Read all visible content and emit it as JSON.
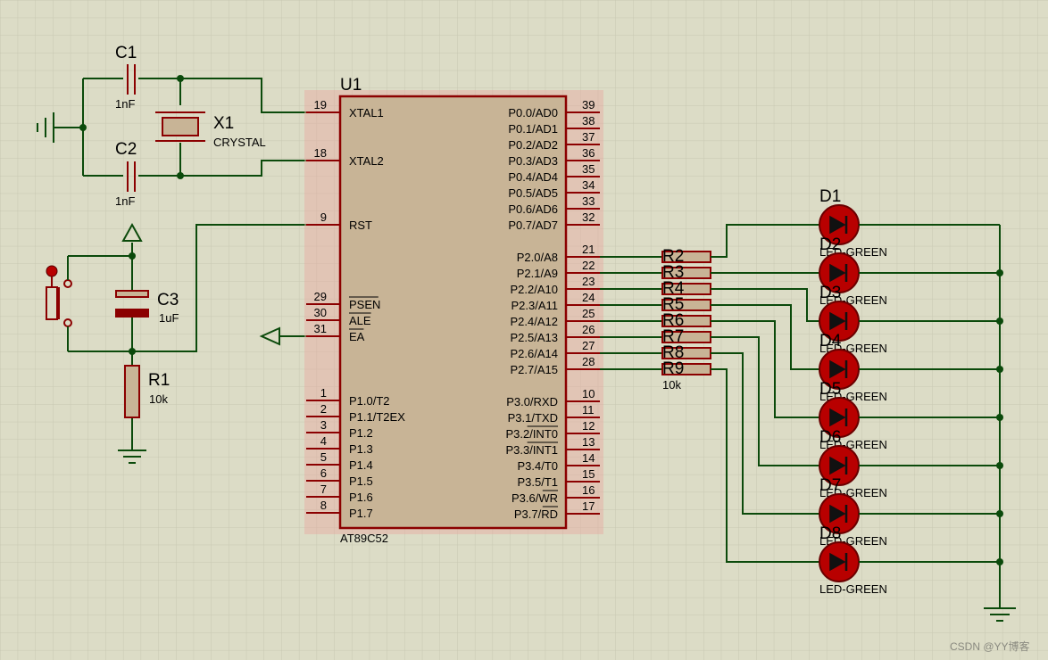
{
  "mcu": {
    "ref": "U1",
    "part": "AT89C52",
    "left_pins": [
      {
        "num": "19",
        "name": "XTAL1"
      },
      {
        "num": "18",
        "name": "XTAL2"
      },
      {
        "num": "9",
        "name": "RST"
      },
      {
        "num": "29",
        "name": "PSEN",
        "overline": true
      },
      {
        "num": "30",
        "name": "ALE",
        "overline": true
      },
      {
        "num": "31",
        "name": "EA",
        "overline": true
      },
      {
        "num": "1",
        "name": "P1.0/T2"
      },
      {
        "num": "2",
        "name": "P1.1/T2EX"
      },
      {
        "num": "3",
        "name": "P1.2"
      },
      {
        "num": "4",
        "name": "P1.3"
      },
      {
        "num": "5",
        "name": "P1.4"
      },
      {
        "num": "6",
        "name": "P1.5"
      },
      {
        "num": "7",
        "name": "P1.6"
      },
      {
        "num": "8",
        "name": "P1.7"
      }
    ],
    "right_pins": [
      {
        "num": "39",
        "name": "P0.0/AD0"
      },
      {
        "num": "38",
        "name": "P0.1/AD1"
      },
      {
        "num": "37",
        "name": "P0.2/AD2"
      },
      {
        "num": "36",
        "name": "P0.3/AD3"
      },
      {
        "num": "35",
        "name": "P0.4/AD4"
      },
      {
        "num": "34",
        "name": "P0.5/AD5"
      },
      {
        "num": "33",
        "name": "P0.6/AD6"
      },
      {
        "num": "32",
        "name": "P0.7/AD7"
      },
      {
        "num": "21",
        "name": "P2.0/A8"
      },
      {
        "num": "22",
        "name": "P2.1/A9"
      },
      {
        "num": "23",
        "name": "P2.2/A10"
      },
      {
        "num": "24",
        "name": "P2.3/A11"
      },
      {
        "num": "25",
        "name": "P2.4/A12"
      },
      {
        "num": "26",
        "name": "P2.5/A13"
      },
      {
        "num": "27",
        "name": "P2.6/A14"
      },
      {
        "num": "28",
        "name": "P2.7/A15"
      },
      {
        "num": "10",
        "name": "P3.0/RXD"
      },
      {
        "num": "11",
        "name": "P3.1/TXD"
      },
      {
        "num": "12",
        "name": "P3.2/INT0",
        "over_part": "INT0"
      },
      {
        "num": "13",
        "name": "P3.3/INT1",
        "over_part": "INT1"
      },
      {
        "num": "14",
        "name": "P3.4/T0"
      },
      {
        "num": "15",
        "name": "P3.5/T1"
      },
      {
        "num": "16",
        "name": "P3.6/WR",
        "over_part": "WR"
      },
      {
        "num": "17",
        "name": "P3.7/RD",
        "over_part": "RD"
      }
    ]
  },
  "c1": {
    "ref": "C1",
    "value": "1nF"
  },
  "c2": {
    "ref": "C2",
    "value": "1nF"
  },
  "x1": {
    "ref": "X1",
    "value": "CRYSTAL"
  },
  "c3": {
    "ref": "C3",
    "value": "1uF"
  },
  "r1": {
    "ref": "R1",
    "value": "10k"
  },
  "resistors": {
    "refs": [
      "R2",
      "R3",
      "R4",
      "R5",
      "R6",
      "R7",
      "R8",
      "R9"
    ],
    "value": "10k"
  },
  "leds": {
    "refs": [
      "D1",
      "D2",
      "D3",
      "D4",
      "D5",
      "D6",
      "D7",
      "D8"
    ],
    "value": "LED-GREEN"
  },
  "watermark": "CSDN @YY博客",
  "colors": {
    "background": "#dcdcc6",
    "wire": "#0b4a0b",
    "component": "#8b0000",
    "chip_fill": "#c8b496",
    "led_fill": "#b80000"
  }
}
